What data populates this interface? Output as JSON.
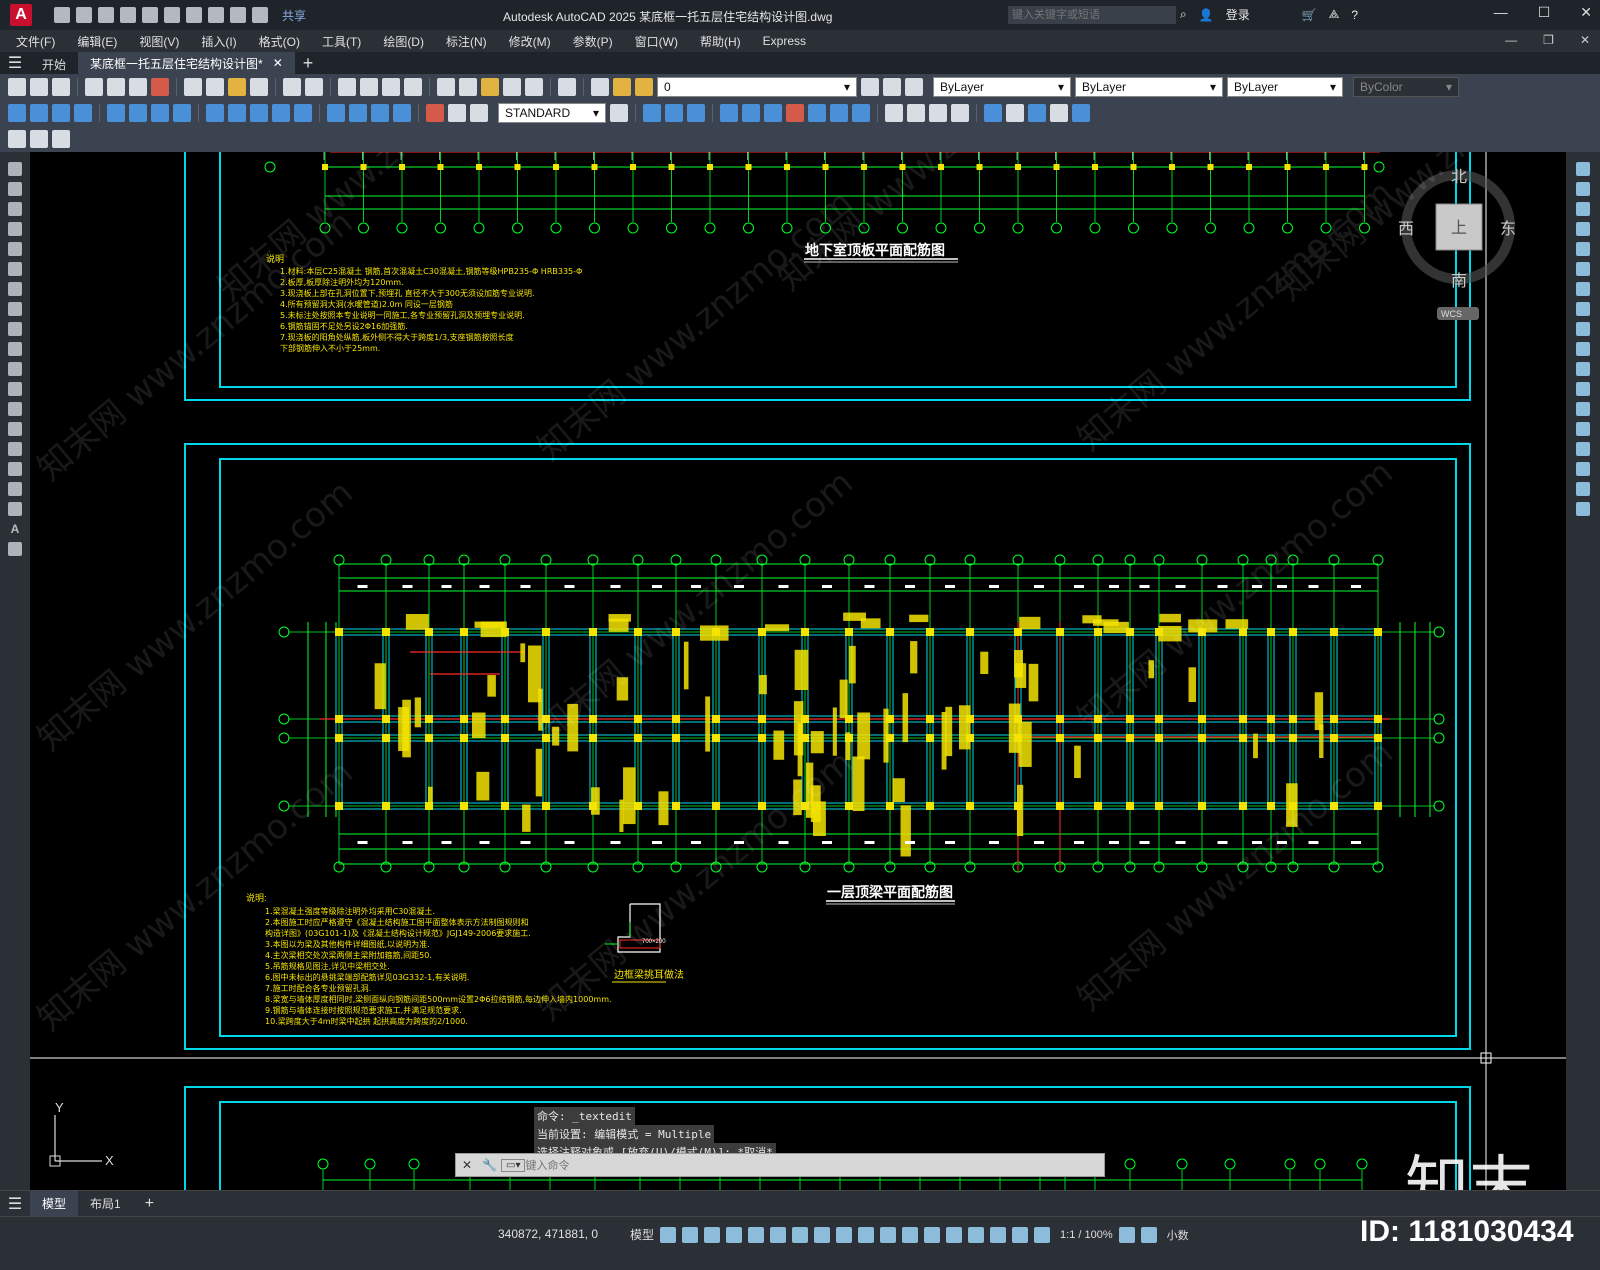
{
  "app": {
    "logo_letter": "A",
    "share_label": "共享",
    "window_title": "Autodesk AutoCAD 2025    某底框一托五层住宅结构设计图.dwg",
    "search_placeholder": "键入关键字或短语",
    "login_label": "登录"
  },
  "menu": {
    "items": [
      "文件(F)",
      "编辑(E)",
      "视图(V)",
      "插入(I)",
      "格式(O)",
      "工具(T)",
      "绘图(D)",
      "标注(N)",
      "修改(M)",
      "参数(P)",
      "窗口(W)",
      "帮助(H)",
      "Express"
    ]
  },
  "tabs": {
    "start": "开始",
    "document": "某底框一托五层住宅结构设计图*"
  },
  "layer_toolbar": {
    "layer_value": "0",
    "color_value": "ByLayer",
    "linetype_value": "ByLayer",
    "lineweight_value": "ByLayer",
    "plotstyle_value": "ByColor"
  },
  "style_toolbar": {
    "dimstyle_value": "STANDARD"
  },
  "viewcube": {
    "north": "北",
    "south": "南",
    "east": "东",
    "west": "西",
    "face": "上",
    "wcs": "WCS"
  },
  "drawing": {
    "title_basement": "地下室顶板平面配筋图",
    "title_first_floor": "一层顶梁平面配筋图",
    "notes_header_1": "说明",
    "notes_header_2": "说明:",
    "notes_1": [
      "1.材料:本层C25混凝土 钢筋,首次混凝土C30混凝土,钢筋等级HPB235-Φ HRB335-Φ",
      "2.板厚,板厚除注明外均为120mm.",
      "3.现浇板上部在孔洞位置下,预埋孔 直径不大于300无须设加筋专业说明.",
      "4.所有预留洞大洞(水暖管道)2.0m 同设一层钢筋",
      "5.未标注处按照本专业说明一同施工,各专业预留孔洞及预埋专业说明.",
      "6.钢筋锚固不足处另设2Φ16加强筋.",
      "7.现浇板的阳角处纵筋,板外侧不得大于跨度1/3,支座钢筋按照长度",
      "  下部钢筋伸入不小于25mm."
    ],
    "notes_2": [
      "1.梁混凝土强度等级除注明外均采用C30混凝土.",
      "2.本图施工时应严格遵守《混凝土结构施工图平面整体表示方法制图规则和",
      "  构造详图》(03G101-1)及《混凝土结构设计规范》JGJ149-2006要求施工.",
      "3.本图以为梁及其他构件详细图纸,以说明为准.",
      "4.主次梁相交处次梁两侧主梁附加箍筋,间距50.",
      "5.吊筋规格见图注,详见中梁相交处.",
      "6.图中未标出的悬挑梁端部配筋详见03G332-1,有关说明.",
      "7.施工时配合各专业预留孔洞.",
      "8.梁宽与墙体厚度相同时,梁侧面纵向钢筋间距500mm设置2Φ6拉结钢筋,每边伸入墙内1000mm.",
      "9.钢筋与墙体连接时按照规范要求施工,并满足规范要求.",
      "10.梁跨度大于4m时梁中起拱 起拱高度为跨度的2/1000."
    ],
    "detail_title": "边框梁挑耳做法",
    "detail_dim": "700×200"
  },
  "command": {
    "history": [
      "命令: _textedit",
      "当前设置: 编辑模式 = Multiple",
      "选择注释对象或 [放弃(U)/模式(M)]: *取消*"
    ],
    "input_placeholder": "键入命令"
  },
  "layouts": {
    "model": "模型",
    "layout1": "布局1"
  },
  "status": {
    "coordinates": "340872, 471881, 0",
    "model_label": "模型",
    "scale": "1:1 / 100%",
    "units": "小数"
  },
  "watermark": {
    "logo": "知末",
    "id": "ID: 1181030434",
    "site": "www.znzmo.com",
    "cn": "知末网"
  },
  "colors": {
    "canvas_bg": "#000000",
    "frame_cyan": "#00d7e8",
    "grid_green": "#00ff2a",
    "beam_red": "#ff2a2a",
    "column_yellow": "#f5e400",
    "label_white": "#ffffff"
  }
}
